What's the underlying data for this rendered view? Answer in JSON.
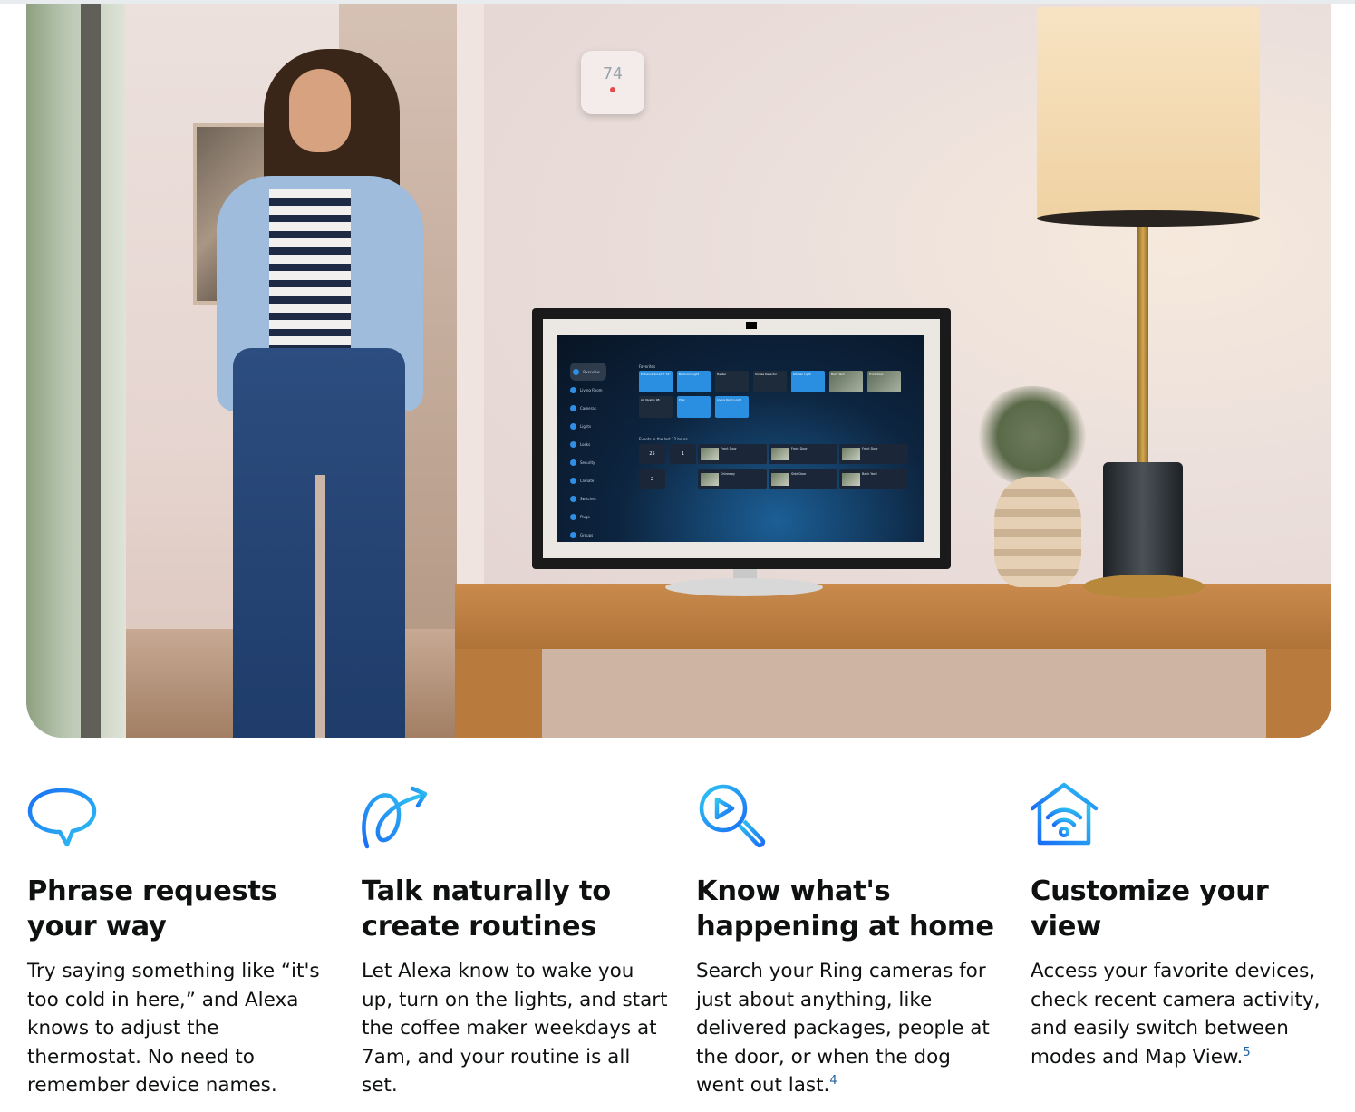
{
  "hero": {
    "thermostat_readout": "74",
    "screen": {
      "sidebar": [
        "Overview",
        "Living Room",
        "Cameras",
        "Lights",
        "Locks",
        "Security",
        "Climate",
        "Switches",
        "Plugs",
        "Groups"
      ],
      "favorites_heading": "Favorites",
      "tiles_row1": [
        "Entrance Smart T",
        "Bedroom Light",
        "Heater",
        "Smoke Detector",
        "Kitchen Light",
        "Back Yard",
        "Front Door"
      ],
      "tiles_row2": [
        "Air Quality",
        "Plug",
        "Living Room Light"
      ],
      "tile_temp": "74°",
      "tile_aq": "98",
      "events_heading": "Events in the last 12 hours",
      "event_counts": [
        "25",
        "1",
        "2"
      ],
      "events": [
        "Front Door",
        "Front Door",
        "Front Door",
        "Driveway",
        "Side Door",
        "Back Yard"
      ]
    }
  },
  "features": [
    {
      "icon": "speech-bubble-icon",
      "title": "Phrase requests your way",
      "body": "Try saying something like “it's too cold in here,” and Alexa knows to adjust the thermostat. No need to remember device names.",
      "footnote": ""
    },
    {
      "icon": "routine-loop-arrow-icon",
      "title": "Talk naturally to create routines",
      "body": "Let Alexa know to wake you up, turn on the lights, and start the coffee maker weekdays at 7am, and your routine is all set.",
      "footnote": ""
    },
    {
      "icon": "video-search-icon",
      "title": "Know what's happening at home",
      "body": "Search your Ring cameras for just about anything, like delivered packages, people at the door, or when the dog went out last.",
      "footnote": "4"
    },
    {
      "icon": "home-wifi-icon",
      "title": "Customize your view",
      "body": "Access your favorite devices, check recent camera activity, and easily switch between modes and Map View.",
      "footnote": "5"
    }
  ],
  "colors": {
    "icon_gradient_start": "#1a7cf5",
    "icon_gradient_end": "#2fc4f0",
    "text": "#0f1111",
    "footnote": "#2162a1"
  }
}
